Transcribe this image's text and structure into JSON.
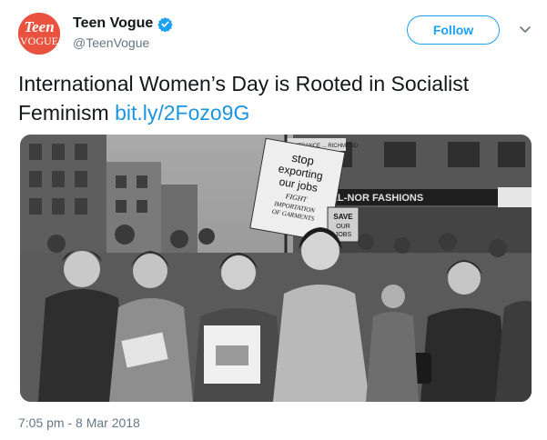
{
  "account": {
    "display_name": "Teen Vogue",
    "handle": "@TeenVogue",
    "avatar_text_top": "Teen",
    "avatar_text_bottom": "VOGUE",
    "verified": true
  },
  "follow_label": "Follow",
  "tweet": {
    "text": "International Women’s Day is Rooted in Socialist Feminism",
    "link": "bit.ly/2Fozo9G"
  },
  "photo": {
    "storefront_sign": "ELL-NOR FASHIONS",
    "street_sign": "ENTRANCE ... RICHMOND",
    "placard": [
      "stop",
      "exporting",
      "our jobs",
      "FIGHT",
      "IMPORTATION",
      "OF GARMENTS"
    ],
    "small_sign": [
      "SAVE",
      "OUR",
      "JOBS"
    ]
  },
  "timestamp": "7:05 pm - 8 Mar 2018",
  "colors": {
    "brand_blue": "#1da1f2",
    "link_blue": "#1b95e0",
    "avatar_red": "#e8523f",
    "secondary_text": "#657786"
  }
}
